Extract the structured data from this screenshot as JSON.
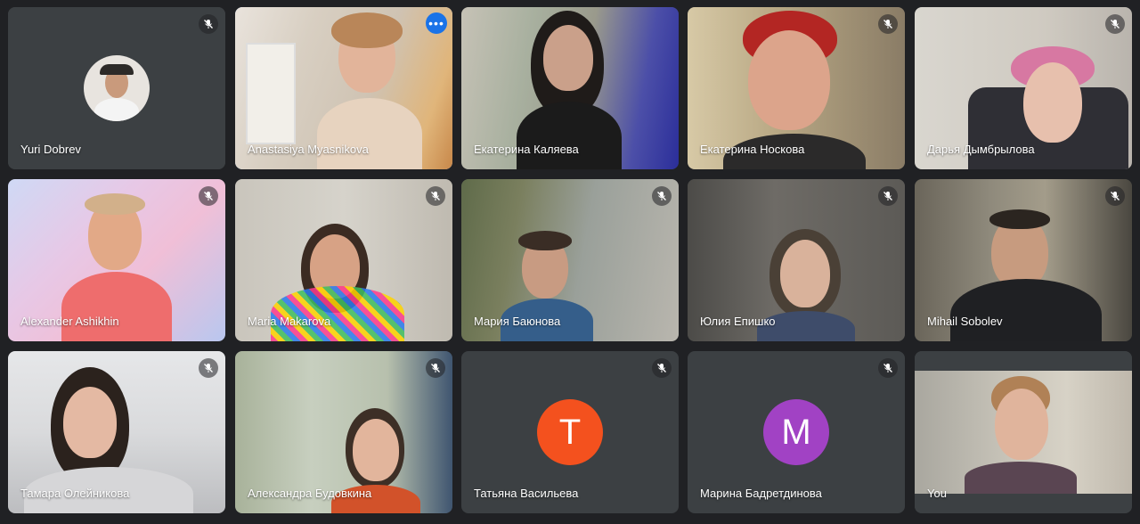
{
  "participants": [
    {
      "name": "Yuri Dobrev",
      "muted": true,
      "type": "avatar-photo"
    },
    {
      "name": "Anastasiya Myasnikova",
      "muted": false,
      "type": "video",
      "active": true
    },
    {
      "name": "Екатерина Каляева",
      "muted": false,
      "type": "video"
    },
    {
      "name": "Екатерина Носкова",
      "muted": true,
      "type": "video"
    },
    {
      "name": "Дарья Дымбрылова",
      "muted": true,
      "type": "video"
    },
    {
      "name": "Alexander Ashikhin",
      "muted": true,
      "type": "video"
    },
    {
      "name": "Maria Makarova",
      "muted": true,
      "type": "video"
    },
    {
      "name": "Мария Баюнова",
      "muted": true,
      "type": "video"
    },
    {
      "name": "Юлия Епишко",
      "muted": true,
      "type": "video"
    },
    {
      "name": "Mihail Sobolev",
      "muted": true,
      "type": "video"
    },
    {
      "name": "Тамара Олейникова",
      "muted": true,
      "type": "video"
    },
    {
      "name": "Александра Будовкина",
      "muted": true,
      "type": "video"
    },
    {
      "name": "Татьяна Васильева",
      "muted": true,
      "type": "initial",
      "initial": "T",
      "color": "#f4511e"
    },
    {
      "name": "Марина Бадретдинова",
      "muted": true,
      "type": "initial",
      "initial": "M",
      "color": "#a142c4"
    },
    {
      "name": "You",
      "muted": false,
      "type": "video"
    }
  ],
  "colors": {
    "background": "#202124",
    "tile": "#3c4043",
    "active_outline": "#8ab4f8",
    "more_button": "#1a73e8"
  },
  "icons": {
    "muted": "mic-off-icon",
    "more": "more-options-icon"
  }
}
